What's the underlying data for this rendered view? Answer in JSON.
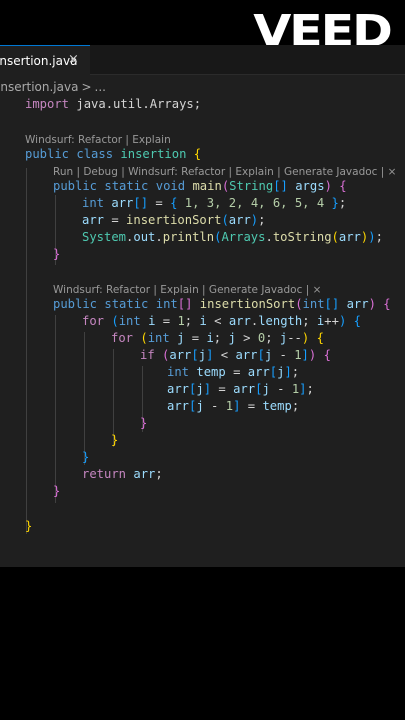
{
  "watermark": "VEED",
  "tab": {
    "label": "insertion.java",
    "close": "×"
  },
  "breadcrumb": {
    "file": "insertion.java",
    "sep": ">",
    "more": "..."
  },
  "codelens": {
    "class": "Windsurf: Refactor | Explain",
    "main": "Run | Debug | Windsurf: Refactor | Explain | Generate Javadoc | ×",
    "sort": "Windsurf: Refactor | Explain | Generate Javadoc | ×"
  },
  "code": {
    "import_kw": "import",
    "import_path": "java.util.Arrays;",
    "public": "public",
    "class": "class",
    "class_name": "insertion",
    "static": "static",
    "void": "void",
    "main": "main",
    "String": "String",
    "args": "args",
    "int": "int",
    "arr": "arr",
    "nums": "1, 3, 2, 4, 6, 5, 4",
    "insertionSort": "insertionSort",
    "System": "System",
    "out": "out",
    "println": "println",
    "Arrays": "Arrays",
    "toString": "toString",
    "for": "for",
    "i": "i",
    "j": "j",
    "length": "length",
    "if": "if",
    "temp": "temp",
    "return": "return"
  }
}
